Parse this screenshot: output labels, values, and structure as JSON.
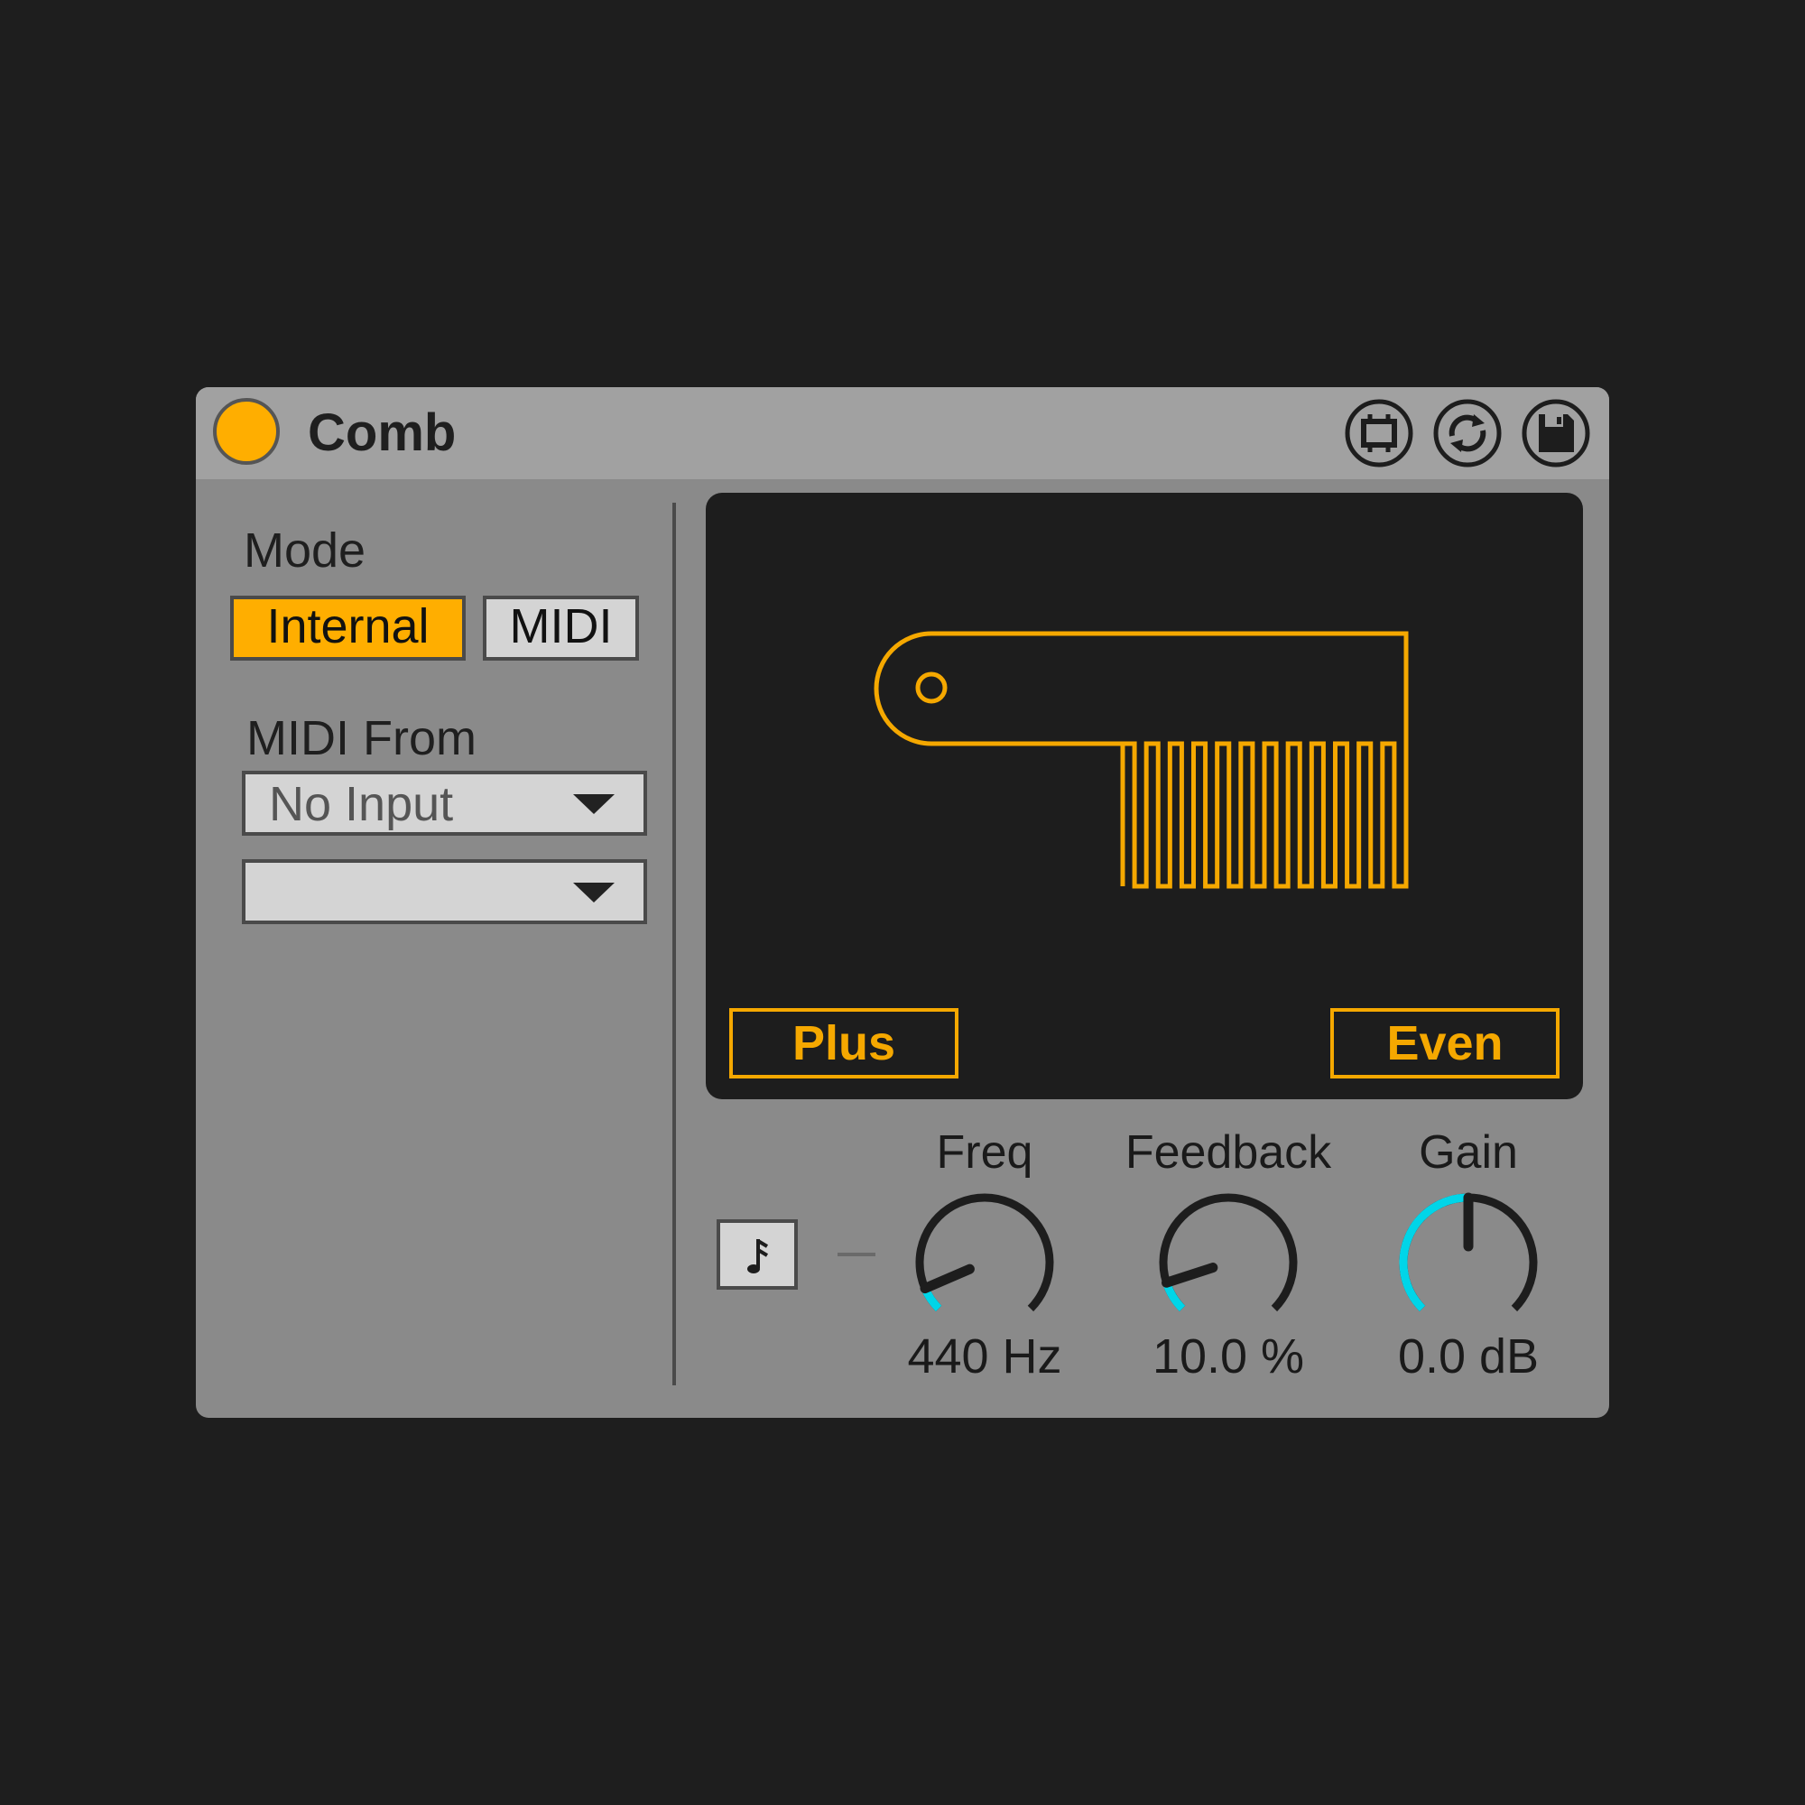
{
  "device": {
    "title": "Comb",
    "power_on": true,
    "title_buttons": [
      "hot-swap-icon",
      "reset-icon",
      "save-icon"
    ]
  },
  "mode": {
    "label": "Mode",
    "options": [
      "Internal",
      "MIDI"
    ],
    "selected": "Internal"
  },
  "midi_from": {
    "label": "MIDI From",
    "input_value": "No Input",
    "channel_value": ""
  },
  "display": {
    "graphic": "comb-icon",
    "polarity_button": "Plus",
    "harmonics_button": "Even"
  },
  "snap_button": {
    "icon": "note-icon"
  },
  "knobs": [
    {
      "label": "Freq",
      "value": "440 Hz",
      "fraction": 0.08,
      "accent": "#00d5e8"
    },
    {
      "label": "Feedback",
      "value": "10.0 %",
      "fraction": 0.1,
      "accent": "#00d5e8"
    },
    {
      "label": "Gain",
      "value": "0.0 dB",
      "fraction": 0.5,
      "accent": "#00d5e8"
    }
  ],
  "colors": {
    "accent_orange": "#ffae00",
    "display_orange": "#f5a800",
    "knob_accent": "#00d5e8",
    "device_bg": "#8a8a8a",
    "titlebar_bg": "#a1a1a1",
    "display_bg": "#1d1d1d"
  }
}
